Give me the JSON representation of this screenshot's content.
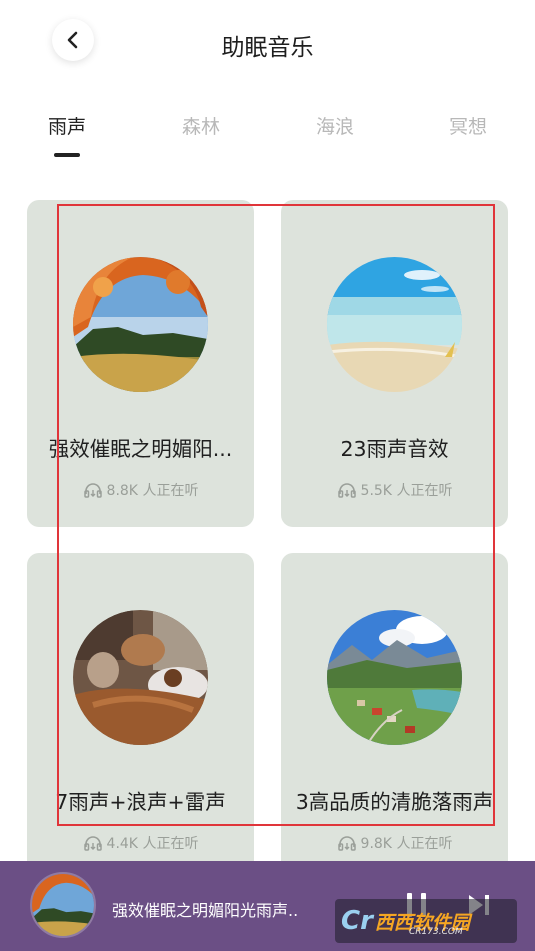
{
  "header": {
    "title": "助眠音乐"
  },
  "icons": {
    "back": "chevron-left-icon",
    "listen": "headphones-icon",
    "pause": "pause-icon",
    "next": "skip-next-icon"
  },
  "tabs": [
    {
      "label": "雨声",
      "active": true
    },
    {
      "label": "森林",
      "active": false
    },
    {
      "label": "海浪",
      "active": false
    },
    {
      "label": "冥想",
      "active": false
    }
  ],
  "cards": [
    {
      "name": "强效催眠之明媚阳光雨声",
      "display_name": "强效催眠之明媚阳...",
      "listeners": "8.8K 人正在听",
      "image": "autumn-lake"
    },
    {
      "name": "23雨声音效",
      "display_name": "23雨声音效",
      "listeners": "5.5K 人正在听",
      "image": "beach"
    },
    {
      "name": "7雨声+浪声+雷声",
      "display_name": "7雨声+浪声+雷声",
      "listeners": "4.4K 人正在听",
      "image": "bedroom"
    },
    {
      "name": "3高品质的清脆落雨声",
      "display_name": "3高品质的清脆落雨声",
      "listeners": "9.8K 人正在听",
      "image": "alpine-village"
    }
  ],
  "player": {
    "now_playing": "强效催眠之明媚阳光雨声..",
    "image": "autumn-lake"
  },
  "watermark": {
    "logo": "Cr",
    "text": "西西软件园",
    "sub": "CR173.COM"
  },
  "colors": {
    "card_bg": "#dde3dc",
    "player_bg": "#6b4f85",
    "highlight": "#e0353a",
    "tab_inactive": "#b8b8b8"
  }
}
